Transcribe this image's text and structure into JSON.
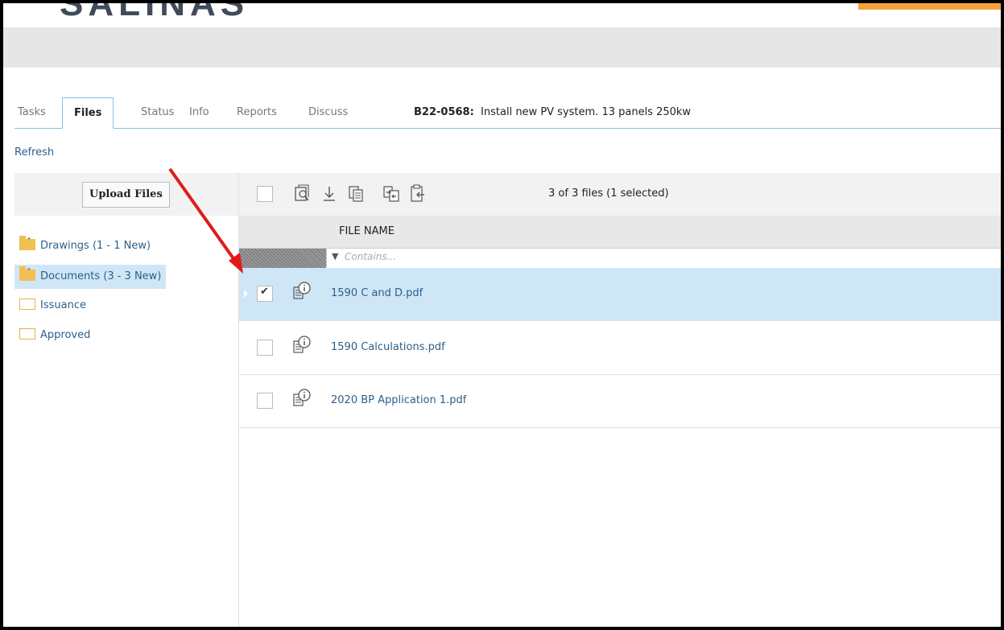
{
  "header": {
    "logo_text": "SALINAS"
  },
  "tabs": [
    {
      "label": "Tasks"
    },
    {
      "label": "Files"
    },
    {
      "label": "Status"
    },
    {
      "label": "Info"
    },
    {
      "label": "Reports"
    },
    {
      "label": "Discuss"
    }
  ],
  "permit": {
    "id": "B22-0568:",
    "description": "Install new PV system. 13 panels 250kw"
  },
  "refresh_label": "Refresh",
  "sidebar": {
    "upload_label": "Upload Files",
    "folders": [
      {
        "label": "Drawings (1 - 1 New)",
        "icon": "folder-filled-icon"
      },
      {
        "label": "Documents (3 - 3 New)",
        "icon": "folder-filled-icon",
        "selected": true
      },
      {
        "label": "Issuance",
        "icon": "folder-outline-icon"
      },
      {
        "label": "Approved",
        "icon": "folder-outline-icon"
      }
    ]
  },
  "toolbar": {
    "icons": [
      "preview-icon",
      "download-icon",
      "copy-icon",
      "move-icon",
      "paste-icon"
    ],
    "count_text": "3 of 3 files (1 selected)"
  },
  "grid": {
    "column_header": "FILE NAME",
    "filter_placeholder": "Contains...",
    "rows": [
      {
        "name": "1590 C and D.pdf",
        "checked": true,
        "selected": true
      },
      {
        "name": "1590 Calculations.pdf",
        "checked": false,
        "selected": false
      },
      {
        "name": "2020 BP Application 1.pdf",
        "checked": false,
        "selected": false
      }
    ]
  },
  "colors": {
    "accent": "#2c5f8a",
    "selection": "#cfe6f7",
    "folder": "#f0c052",
    "annotation_arrow": "#e01b1b"
  }
}
